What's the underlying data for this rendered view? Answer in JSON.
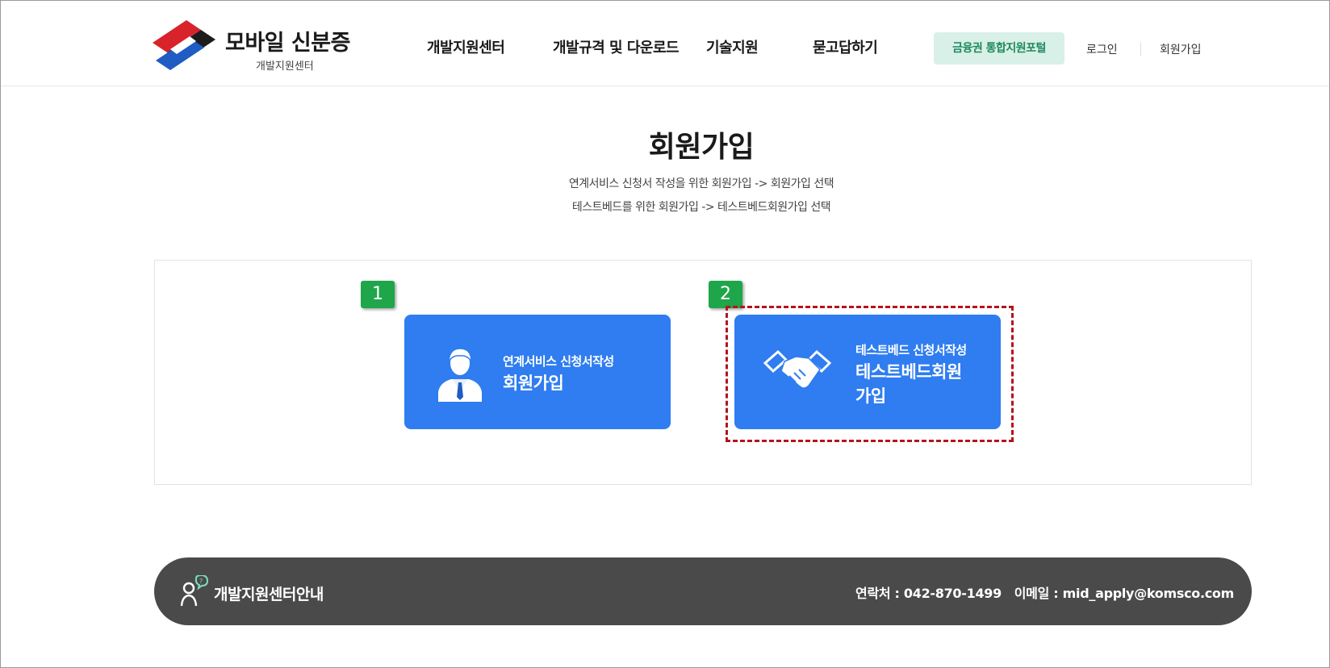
{
  "header": {
    "logo_title": "모바일 신분증",
    "logo_subtitle": "개발지원센터",
    "nav": [
      "개발지원센터",
      "개발규격 및 다운로드",
      "기술지원",
      "묻고답하기"
    ],
    "portal_button": "금융권 통합지원포털",
    "login": "로그인",
    "signup": "회원가입"
  },
  "main": {
    "title": "회원가입",
    "description_lines": [
      "연계서비스 신청서 작성을 위한 회원가입 -> 회원가입 선택",
      "테스트베드를 위한 회원가입 -> 테스트베드회원가입 선택"
    ],
    "options": [
      {
        "badge": "1",
        "small_label": "연계서비스 신청서작성",
        "big_label": "회원가입",
        "icon": "user-icon"
      },
      {
        "badge": "2",
        "small_label": "테스트베드 신청서작성",
        "big_label": "테스트베드회원 가입",
        "big_label_lines": [
          "테스트베드회원",
          "가입"
        ],
        "icon": "handshake-icon",
        "highlighted": true
      }
    ]
  },
  "footer": {
    "title": "개발지원센터안내",
    "contact_label": "연락처 : 042-870-1499",
    "email_label": "이메일 : mid_apply@komsco.com"
  },
  "colors": {
    "card_blue": "#2f7df0",
    "badge_green": "#1fa64a",
    "portal_bg": "#d9f0e8",
    "portal_text": "#1d8a5b",
    "highlight_dash": "#b3141d",
    "footer_bg": "#4a4a4a"
  }
}
